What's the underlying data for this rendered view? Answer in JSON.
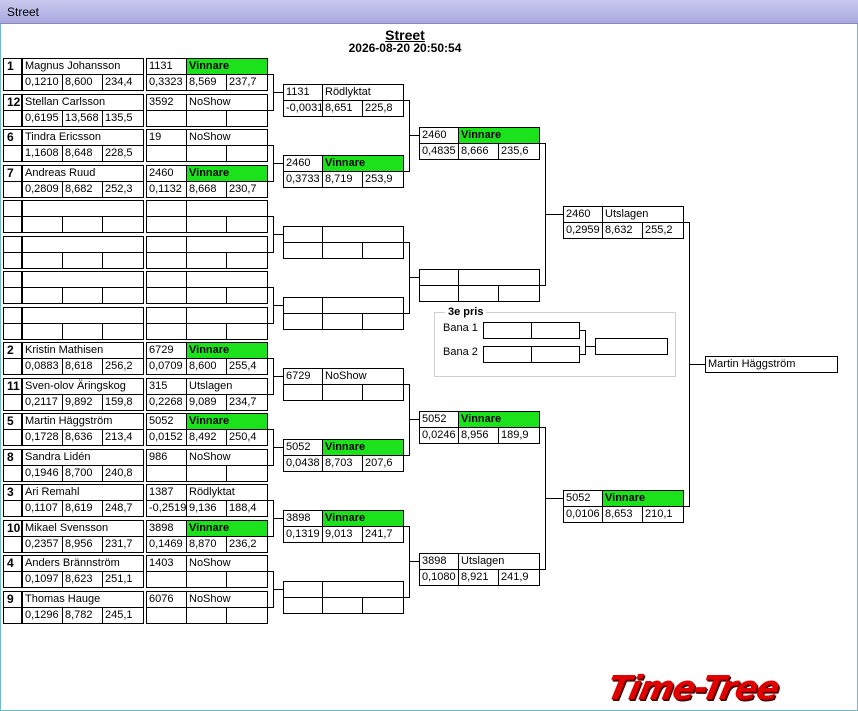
{
  "window": {
    "title": "Street"
  },
  "event": {
    "title": "Street",
    "datetime": "2026-08-20 20:50:54"
  },
  "first_round": [
    {
      "seed": "1",
      "name": "Magnus Johansson",
      "rt": "0,1210",
      "et": "8,600",
      "speed": "234,4",
      "run_number": "1131",
      "run_status": "Vinnare",
      "run_rt": "0,3323",
      "run_et": "8,569",
      "run_speed": "237,7"
    },
    {
      "seed": "12",
      "name": "Stellan Carlsson",
      "rt": "0,6195",
      "et": "13,568",
      "speed": "135,5",
      "run_number": "3592",
      "run_status": "NoShow",
      "run_rt": "",
      "run_et": "",
      "run_speed": ""
    },
    {
      "seed": "6",
      "name": "Tindra  Ericsson",
      "rt": "1,1608",
      "et": "8,648",
      "speed": "228,5",
      "run_number": "19",
      "run_status": "NoShow",
      "run_rt": "",
      "run_et": "",
      "run_speed": ""
    },
    {
      "seed": "7",
      "name": "Andreas  Ruud",
      "rt": "0,2809",
      "et": "8,682",
      "speed": "252,3",
      "run_number": "2460",
      "run_status": "Vinnare",
      "run_rt": "0,1132",
      "run_et": "8,668",
      "run_speed": "230,7"
    },
    {
      "seed": "",
      "name": "",
      "rt": "",
      "et": "",
      "speed": "",
      "run_number": "",
      "run_status": "",
      "run_rt": "",
      "run_et": "",
      "run_speed": ""
    },
    {
      "seed": "",
      "name": "",
      "rt": "",
      "et": "",
      "speed": "",
      "run_number": "",
      "run_status": "",
      "run_rt": "",
      "run_et": "",
      "run_speed": ""
    },
    {
      "seed": "",
      "name": "",
      "rt": "",
      "et": "",
      "speed": "",
      "run_number": "",
      "run_status": "",
      "run_rt": "",
      "run_et": "",
      "run_speed": ""
    },
    {
      "seed": "",
      "name": "",
      "rt": "",
      "et": "",
      "speed": "",
      "run_number": "",
      "run_status": "",
      "run_rt": "",
      "run_et": "",
      "run_speed": ""
    },
    {
      "seed": "2",
      "name": "Kristin Mathisen",
      "rt": "0,0883",
      "et": "8,618",
      "speed": "256,2",
      "run_number": "6729",
      "run_status": "Vinnare",
      "run_rt": "0,0709",
      "run_et": "8,600",
      "run_speed": "255,4"
    },
    {
      "seed": "11",
      "name": "Sven-olov Äringskog",
      "rt": "0,2117",
      "et": "9,892",
      "speed": "159,8",
      "run_number": "315",
      "run_status": "Utslagen",
      "run_rt": "0,2268",
      "run_et": "9,089",
      "run_speed": "234,7"
    },
    {
      "seed": "5",
      "name": "Martin Häggström",
      "rt": "0,1728",
      "et": "8,636",
      "speed": "213,4",
      "run_number": "5052",
      "run_status": "Vinnare",
      "run_rt": "0,0152",
      "run_et": "8,492",
      "run_speed": "250,4"
    },
    {
      "seed": "8",
      "name": "Sandra Lidén",
      "rt": "0,1946",
      "et": "8,700",
      "speed": "240,8",
      "run_number": "986",
      "run_status": "NoShow",
      "run_rt": "",
      "run_et": "",
      "run_speed": ""
    },
    {
      "seed": "3",
      "name": "Ari Remahl",
      "rt": "0,1107",
      "et": "8,619",
      "speed": "248,7",
      "run_number": "1387",
      "run_status": "Rödlyktat",
      "run_rt": "-0,2519",
      "run_et": "9,136",
      "run_speed": "188,4"
    },
    {
      "seed": "10",
      "name": "Mikael  Svensson",
      "rt": "0,2357",
      "et": "8,956",
      "speed": "231,7",
      "run_number": "3898",
      "run_status": "Vinnare",
      "run_rt": "0,1469",
      "run_et": "8,870",
      "run_speed": "236,2"
    },
    {
      "seed": "4",
      "name": "Anders Brännström",
      "rt": "0,1097",
      "et": "8,623",
      "speed": "251,1",
      "run_number": "1403",
      "run_status": "NoShow",
      "run_rt": "",
      "run_et": "",
      "run_speed": ""
    },
    {
      "seed": "9",
      "name": "Thomas Hauge",
      "rt": "0,1296",
      "et": "8,782",
      "speed": "245,1",
      "run_number": "6076",
      "run_status": "NoShow",
      "run_rt": "",
      "run_et": "",
      "run_speed": ""
    }
  ],
  "second_round": [
    {
      "number": "1131",
      "status": "Rödlyktat",
      "rt": "-0,0031",
      "et": "8,651",
      "speed": "225,8"
    },
    {
      "number": "2460",
      "status": "Vinnare",
      "rt": "0,3733",
      "et": "8,719",
      "speed": "253,9"
    },
    {
      "number": "",
      "status": "",
      "rt": "",
      "et": "",
      "speed": ""
    },
    {
      "number": "",
      "status": "",
      "rt": "",
      "et": "",
      "speed": ""
    },
    {
      "number": "6729",
      "status": "NoShow",
      "rt": "",
      "et": "",
      "speed": ""
    },
    {
      "number": "5052",
      "status": "Vinnare",
      "rt": "0,0438",
      "et": "8,703",
      "speed": "207,6"
    },
    {
      "number": "3898",
      "status": "Vinnare",
      "rt": "0,1319",
      "et": "9,013",
      "speed": "241,7"
    },
    {
      "number": "",
      "status": "",
      "rt": "",
      "et": "",
      "speed": ""
    }
  ],
  "quarter_final": [
    {
      "number": "2460",
      "status": "Vinnare",
      "rt": "0,4835",
      "et": "8,666",
      "speed": "235,6"
    },
    {
      "number": "",
      "status": "",
      "rt": "",
      "et": "",
      "speed": ""
    },
    {
      "number": "5052",
      "status": "Vinnare",
      "rt": "0,0246",
      "et": "8,956",
      "speed": "189,9"
    },
    {
      "number": "3898",
      "status": "Utslagen",
      "rt": "0,1080",
      "et": "8,921",
      "speed": "241,9"
    }
  ],
  "semi_final": [
    {
      "number": "2460",
      "status": "Utslagen",
      "rt": "0,2959",
      "et": "8,632",
      "speed": "255,2"
    },
    {
      "number": "5052",
      "status": "Vinnare",
      "rt": "0,0106",
      "et": "8,653",
      "speed": "210,1"
    }
  ],
  "final": {
    "winner": "Martin Häggström"
  },
  "third_place": {
    "title": "3e pris",
    "lane1_label": "Bana 1",
    "lane2_label": "Bana 2",
    "lane1_value": "",
    "lane2_value": "",
    "result": ""
  },
  "logo": {
    "text": "Time-Tree"
  },
  "colors": {
    "winner": "#1ce21c",
    "titlebar": "#b4b4e6",
    "frame": "#6fb9c9",
    "logo": "#e00000"
  }
}
